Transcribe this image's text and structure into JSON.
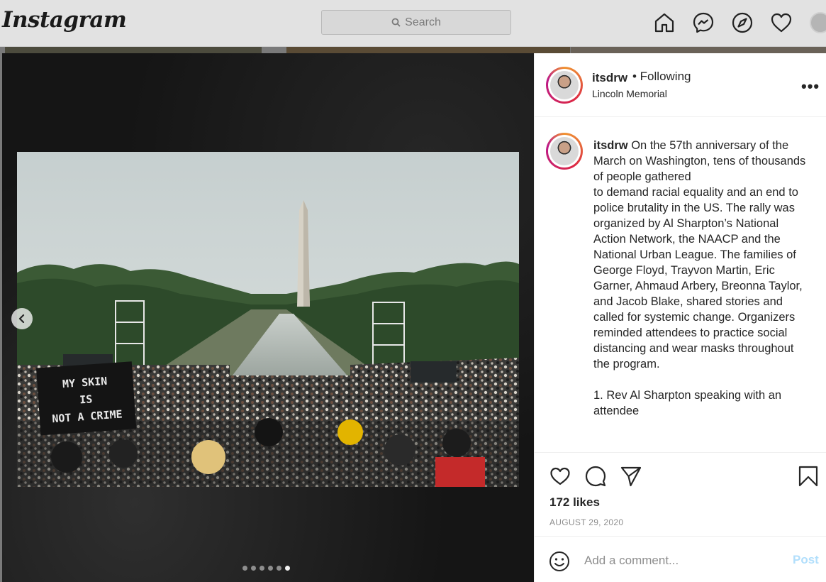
{
  "nav": {
    "logo": "Instagram",
    "search_placeholder": "Search",
    "icons": [
      "home-icon",
      "messenger-icon",
      "explore-icon",
      "activity-heart-icon",
      "profile-avatar"
    ]
  },
  "post": {
    "username": "itsdrw",
    "follow_status": "• Following",
    "location": "Lincoln Memorial",
    "carousel": {
      "total": 6,
      "active": 6
    },
    "sign_text": "MY SKIN IS NOT A CRIME",
    "caption": {
      "username": "itsdrw",
      "text": "On the 57th anniversary of the March on Washington, tens of thousands of people gathered\nto demand racial equality and an end to police brutality in the US. The rally was organized by Al Sharpton’s National Action Network, the NAACP and the National Urban League. The families of George Floyd, Trayvon Martin, Eric Garner, Ahmaud Arbery, Breonna Taylor, and Jacob Blake, shared stories and called for systemic change. Organizers reminded attendees to practice social distancing and wear masks throughout the program.\n\n1. Rev Al Sharpton speaking with an attendee"
    },
    "likes": "172 likes",
    "date": "AUGUST 29, 2020",
    "comment_placeholder": "Add a comment...",
    "post_label": "Post"
  },
  "colors": {
    "post_button_disabled": "#b2dffc",
    "text": "#262626",
    "secondary_text": "#8e8e8e"
  }
}
